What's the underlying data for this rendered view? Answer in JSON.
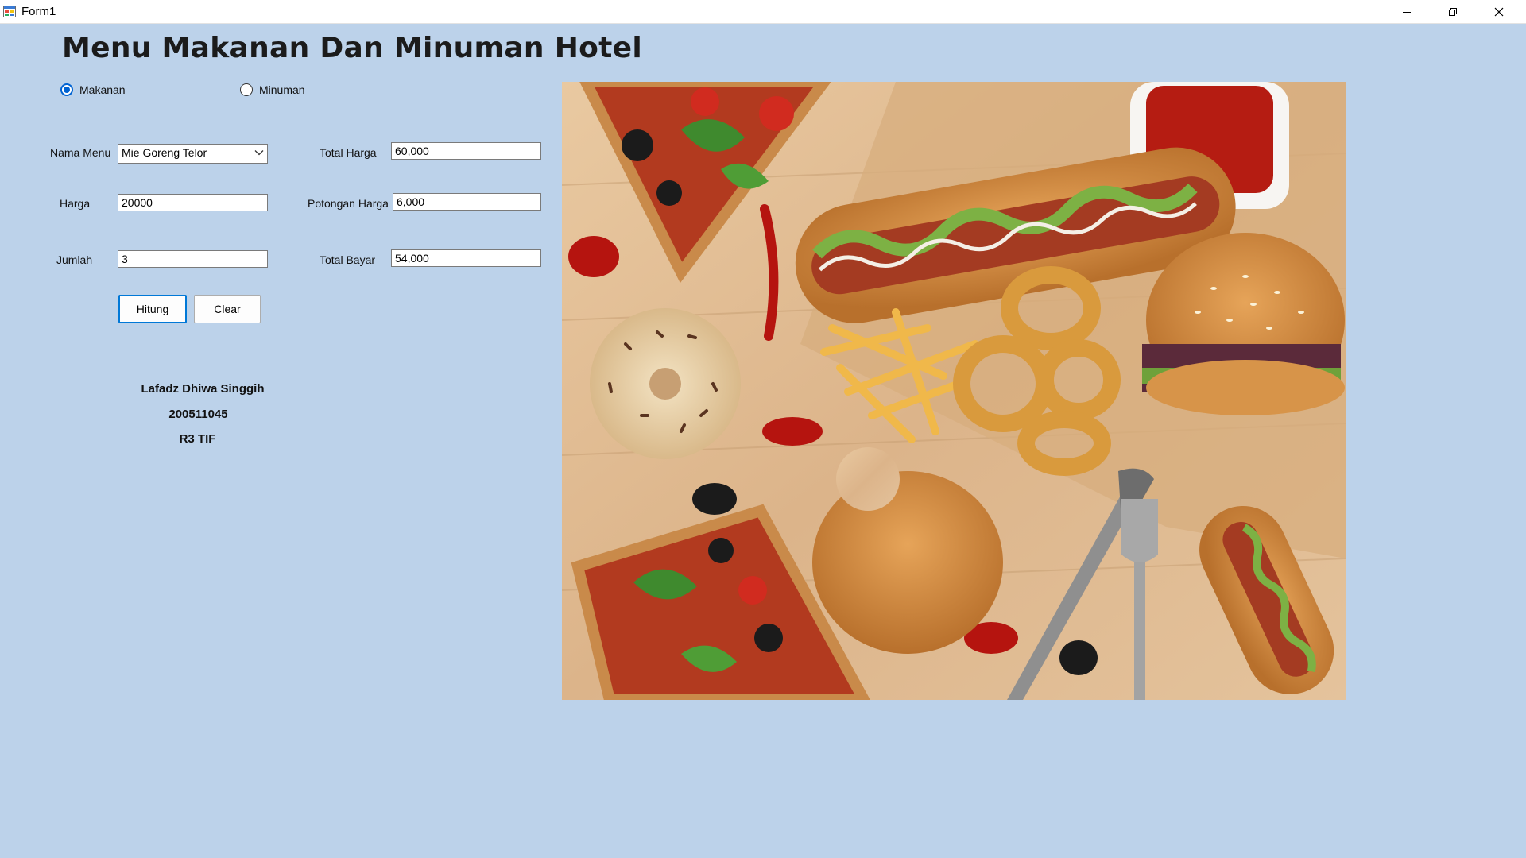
{
  "window": {
    "title": "Form1"
  },
  "form": {
    "heading": "Menu Makanan Dan Minuman Hotel",
    "category": {
      "options": [
        {
          "label": "Makanan",
          "checked": true
        },
        {
          "label": "Minuman",
          "checked": false
        }
      ]
    },
    "fields": {
      "nama_menu": {
        "label": "Nama Menu",
        "value": "Mie Goreng Telor"
      },
      "harga": {
        "label": "Harga",
        "value": "20000"
      },
      "jumlah": {
        "label": "Jumlah",
        "value": "3"
      },
      "total_harga": {
        "label": "Total Harga",
        "value": "60,000"
      },
      "potongan_harga": {
        "label": "Potongan Harga",
        "value": "6,000"
      },
      "total_bayar": {
        "label": "Total Bayar",
        "value": "54,000"
      }
    },
    "buttons": {
      "hitung": "Hitung",
      "clear": "Clear"
    },
    "student": {
      "name": "Lafadz Dhiwa Singgih",
      "id": "200511045",
      "class": "R3 TIF"
    }
  },
  "image": {
    "subject": "fast-food-photo"
  },
  "colors": {
    "form_background": "#bcd2ea",
    "accent": "#0078d7"
  }
}
